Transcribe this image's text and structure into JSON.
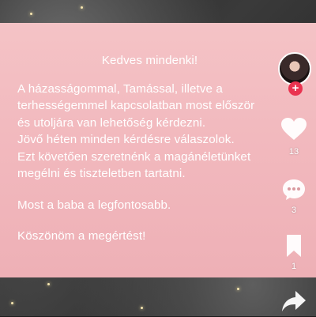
{
  "post": {
    "greeting": "Kedves mindenki!",
    "lines": [
      "A házasságommal, Tamással, illetve a",
      "terhességemmel kapcsolatban most először",
      "és utoljára van lehetőség kérdezni.",
      "Jövő héten minden kérdésre válaszolok.",
      "Ezt követően szeretnénk a magánéletünket",
      "megélni és tiszteletben tartatni."
    ],
    "priority": "Most a baba a legfontosabb.",
    "thanks": "Köszönöm a megértést!"
  },
  "sidebar": {
    "follow_symbol": "+",
    "like_count": "13",
    "comment_count": "3",
    "save_count": "1"
  },
  "colors": {
    "card_pink": "#f2b9be",
    "follow_red": "#ea3350"
  },
  "icons": [
    "avatar",
    "plus-icon",
    "heart-icon",
    "comment-icon",
    "bookmark-icon",
    "share-icon"
  ]
}
